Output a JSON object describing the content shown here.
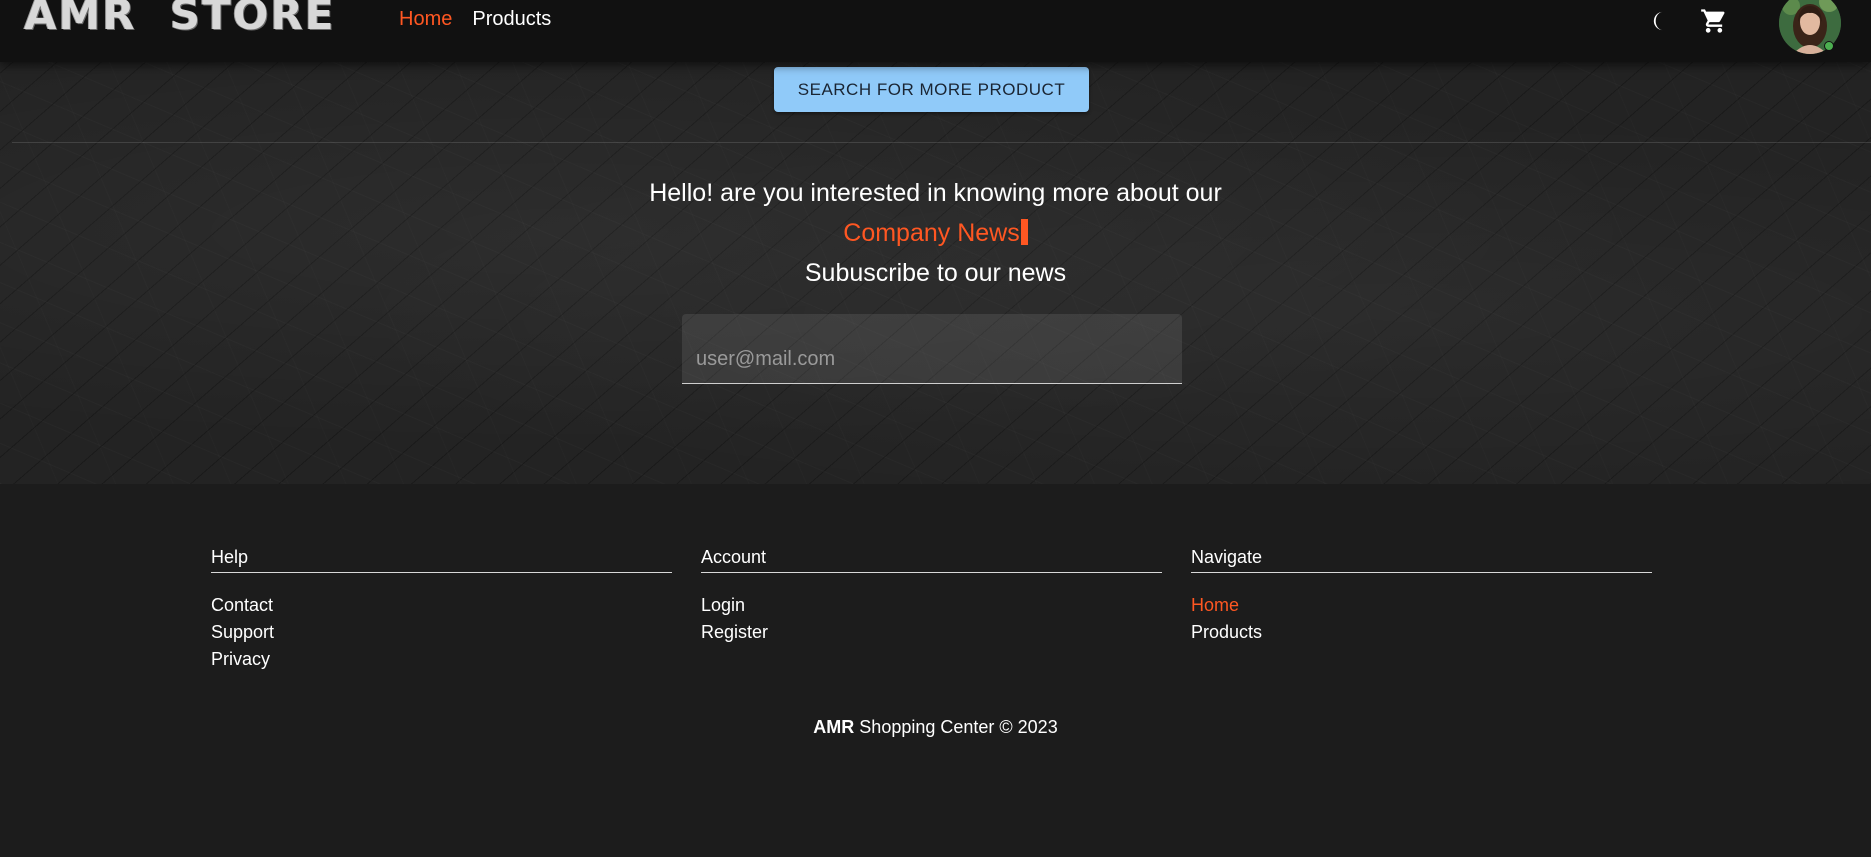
{
  "header": {
    "logo_text": "AMR  STORE",
    "nav": [
      {
        "label": "Home",
        "active": true
      },
      {
        "label": "Products",
        "active": false
      }
    ],
    "icons": [
      "moon-icon",
      "cart-icon"
    ],
    "avatar": "user-avatar"
  },
  "newsletter": {
    "search_more_label": "SEARCH FOR MORE PRODUCT",
    "line1": "Hello! are you interested in knowing more about our",
    "line2": "Company News",
    "line3": "Subuscribe to our news",
    "email_placeholder": "user@mail.com",
    "email_value": ""
  },
  "footer": {
    "columns": [
      {
        "title": "Help",
        "links": [
          "Contact",
          "Support",
          "Privacy"
        ]
      },
      {
        "title": "Account",
        "links": [
          "Login",
          "Register"
        ]
      },
      {
        "title": "Navigate",
        "links": [
          "Home",
          "Products"
        ],
        "active_link": "Home"
      }
    ],
    "copyright_brand": "AMR",
    "copyright_rest": " Shopping Center © 2023"
  },
  "colors": {
    "accent": "#ff5722",
    "button": "#90caf9",
    "nav_bg": "#111111",
    "footer_bg": "#1c1c1c"
  }
}
